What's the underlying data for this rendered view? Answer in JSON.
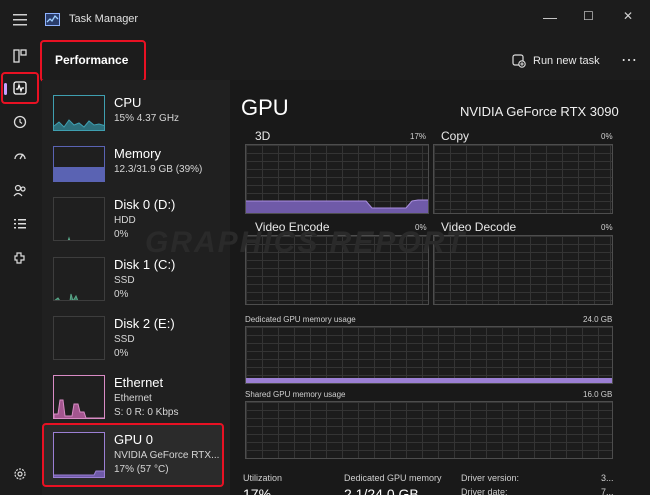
{
  "window": {
    "title": "Task Manager",
    "min_glyph": "—",
    "max_glyph": "☐",
    "close_glyph": "✕"
  },
  "commandbar": {
    "page_title": "Performance",
    "run_new_task": "Run new task",
    "more_glyph": "⋯"
  },
  "sidebar": {
    "items": [
      {
        "title": "CPU",
        "sub1": "15%  4.37 GHz",
        "sub2": ""
      },
      {
        "title": "Memory",
        "sub1": "12.3/31.9 GB (39%)",
        "sub2": ""
      },
      {
        "title": "Disk 0 (D:)",
        "sub1": "HDD",
        "sub2": "0%"
      },
      {
        "title": "Disk 1 (C:)",
        "sub1": "SSD",
        "sub2": "0%"
      },
      {
        "title": "Disk 2 (E:)",
        "sub1": "SSD",
        "sub2": "0%"
      },
      {
        "title": "Ethernet",
        "sub1": "Ethernet",
        "sub2": "S: 0  R: 0 Kbps"
      },
      {
        "title": "GPU 0",
        "sub1": "NVIDIA GeForce RTX...",
        "sub2": "17%  (57 °C)"
      }
    ]
  },
  "gpu": {
    "heading": "GPU",
    "model": "NVIDIA GeForce RTX 3090",
    "engines": [
      {
        "name": "3D",
        "value": "17%"
      },
      {
        "name": "Copy",
        "value": "0%"
      },
      {
        "name": "Video Encode",
        "value": "0%"
      },
      {
        "name": "Video Decode",
        "value": "0%"
      }
    ],
    "dedicated": {
      "label": "Dedicated GPU memory usage",
      "max": "24.0 GB"
    },
    "shared": {
      "label": "Shared GPU memory usage",
      "max": "16.0 GB"
    },
    "stats": {
      "utilization_label": "Utilization",
      "utilization_value": "17%",
      "dedicated_label": "Dedicated GPU memory",
      "dedicated_value": "2.1/24.0 GB",
      "driver_version_label": "Driver version:",
      "driver_version_value": "3...",
      "driver_date_label": "Driver date:",
      "driver_date_value": "7..."
    }
  },
  "watermark": "Graphics Report",
  "colors": {
    "accent": "#9b7fd4",
    "accent_fill": "#6f5aa8",
    "ethernet": "#d98bc5",
    "cpu": "#3f9fb0",
    "memory": "#5a63b3",
    "disk": "#5aa88a",
    "highlight": "#e81123"
  },
  "icons": {
    "hamburger": "hamburger-icon",
    "processes": "processes-icon",
    "performance": "performance-icon",
    "app_history": "app-history-icon",
    "startup": "startup-apps-icon",
    "users": "users-icon",
    "details": "details-icon",
    "services": "services-icon",
    "settings": "settings-icon"
  }
}
